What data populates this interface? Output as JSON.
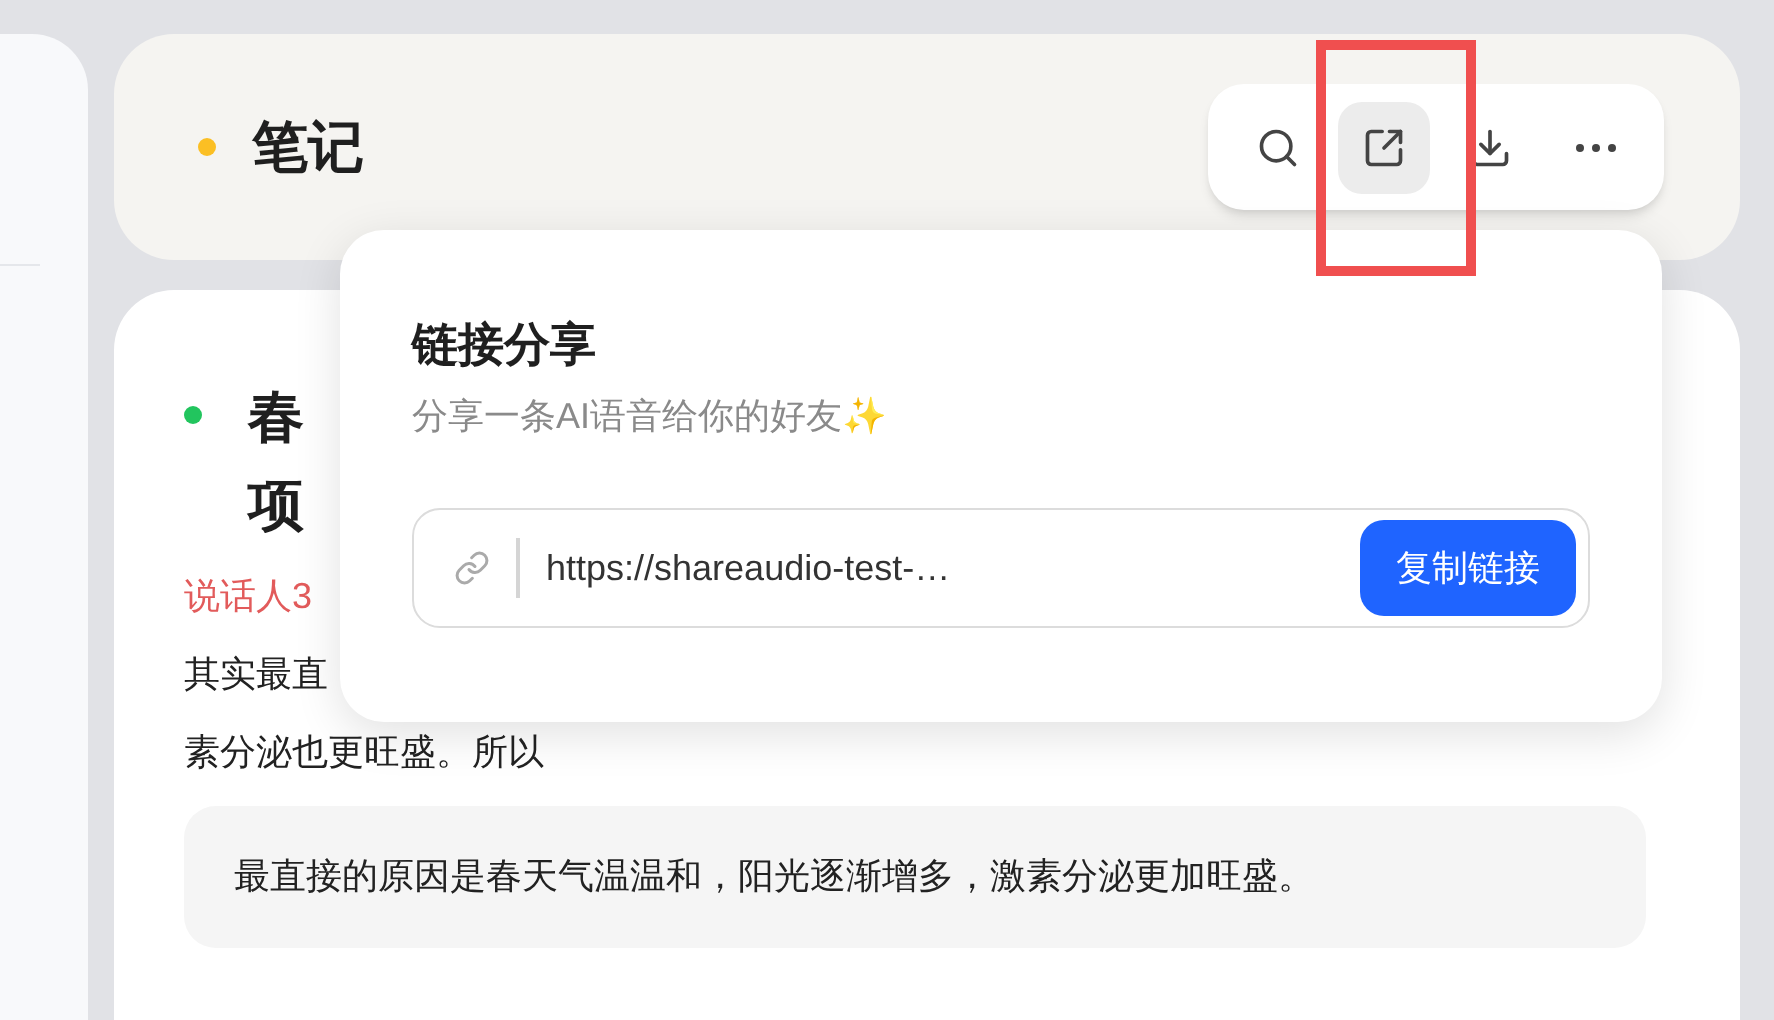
{
  "header": {
    "title": "笔记"
  },
  "toolbar": [
    {
      "kind": "search",
      "highlighted": false,
      "selected": false
    },
    {
      "kind": "share",
      "highlighted": true,
      "selected": true
    },
    {
      "kind": "download",
      "highlighted": false,
      "selected": false
    },
    {
      "kind": "more",
      "highlighted": false,
      "selected": false
    }
  ],
  "note": {
    "title_lines": [
      "春",
      "项"
    ],
    "speaker": "说话人3",
    "paragraph_lines": [
      "其实最直",
      "素分泌也更旺盛。所以"
    ],
    "quote": "最直接的原因是春天气温温和，阳光逐渐增多，激素分泌更加旺盛。"
  },
  "share_popup": {
    "title": "链接分享",
    "subtitle": "分享一条AI语音给你的好友✨",
    "link": "https://shareaudio-test-…",
    "copy_button": "复制链接"
  }
}
